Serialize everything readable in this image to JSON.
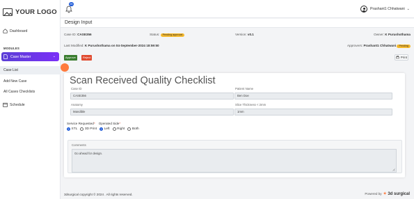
{
  "logo": {
    "text": "YOUR LOGO"
  },
  "sidebar": {
    "dashboard": "Dashboard",
    "modules_label": "MODULES",
    "case_master": "Case Master",
    "sub_items": [
      "Case List",
      "Add New Case",
      "All Cases Checklists"
    ],
    "schedule": "Schedule"
  },
  "header": {
    "notification_count": "99",
    "user_name": "Prashant1 Chhatwani"
  },
  "page": {
    "title": "Design Input"
  },
  "info": {
    "case_id_label": "Case ID:",
    "case_id_value": "CASE356",
    "status_label": "Status:",
    "status_value": "Pending approval",
    "version_label": "Version:",
    "version_value": "v0.1",
    "owner_label": "Owner:",
    "owner_value": "K Purushothama",
    "last_modified_label": "Last Modified:",
    "last_modified_value": "K Purushothama on 04-September-2024 18:59:50",
    "approvers_label": "Approvers:",
    "approvers_value": "Prashant1 Chhatwani",
    "approver_status": "Pending"
  },
  "actions": {
    "approve": "Approve",
    "reject": "Reject",
    "print": "Print"
  },
  "colors": {
    "approve": "#3a7d2f",
    "reject": "#e04a2f",
    "accent": "#6a35e8",
    "badge": "#f5b92e"
  },
  "form": {
    "title": "Scan Received Quality Checklist",
    "case_id_label": "Case ID",
    "case_id_value": "CASE356",
    "patient_name_label": "Patient Name",
    "patient_name_value": "Ben Doe",
    "anatomy_label": "Anatomy",
    "anatomy_value": "Mandible",
    "slice_thickness_label": "Slice Thickness < 2mm",
    "slice_thickness_value": "1mm",
    "service_requested_label": "Service Requested",
    "operated_side_label": "Operated Side",
    "required_mark": "*",
    "options": [
      "STL",
      "3D Print",
      "Left",
      "Right",
      "Both"
    ],
    "comments_label": "Comments",
    "comments_value": "Go ahead for design."
  },
  "footer": {
    "copyright": "3dsurgical copyright © 2024 . All rights reserved.",
    "powered_by": "Powered by",
    "brand": "3d surgical"
  }
}
